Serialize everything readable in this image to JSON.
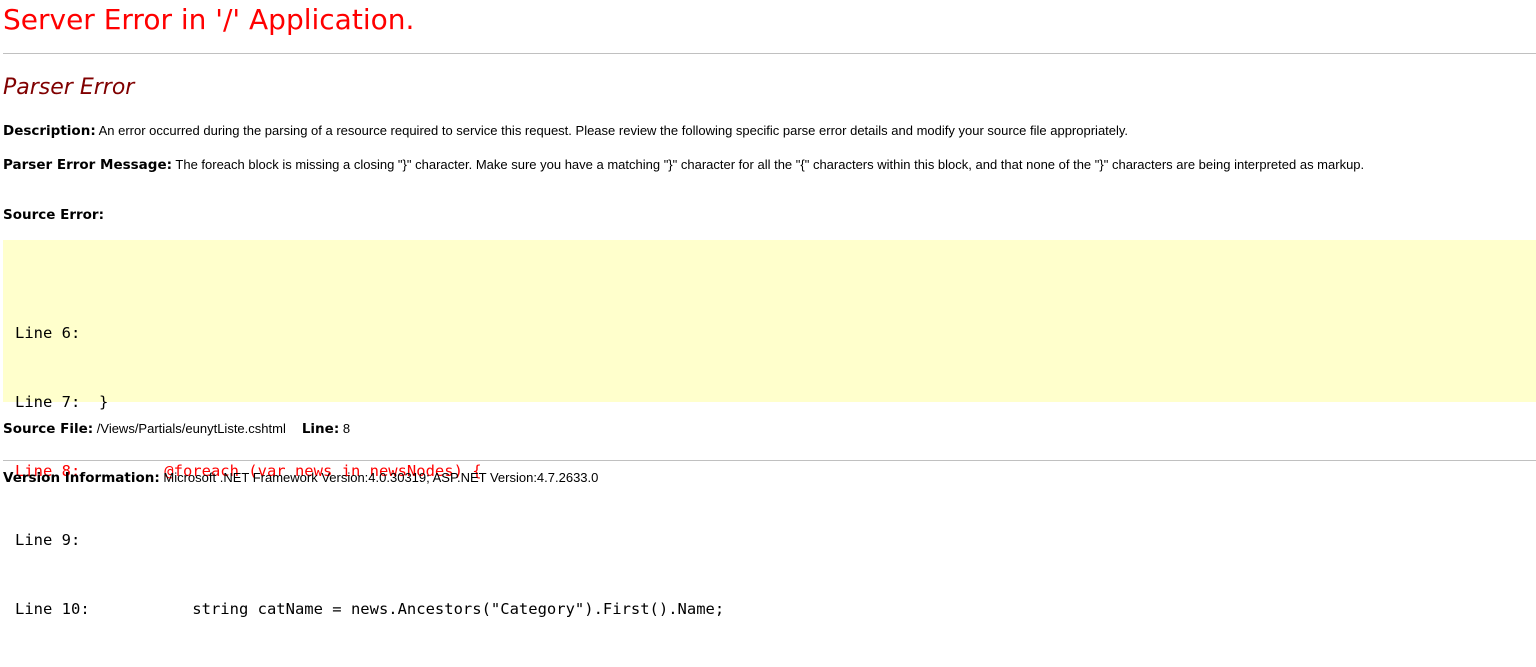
{
  "page": {
    "title": "Server Error in '/' Application.",
    "error_heading": "Parser Error"
  },
  "description": {
    "label": "Description:",
    "text": " An error occurred during the parsing of a resource required to service this request. Please review the following specific parse error details and modify your source file appropriately."
  },
  "parser_message": {
    "label": "Parser Error Message:",
    "text": " The foreach block is missing a closing \"}\" character.  Make sure you have a matching \"}\" character for all the \"{\" characters within this block, and that none of the \"}\" characters are being interpreted as markup."
  },
  "source_error": {
    "label": "Source Error:",
    "lines": [
      {
        "text": "Line 6:   ",
        "highlighted": false
      },
      {
        "text": "Line 7:  }",
        "highlighted": false
      },
      {
        "text": "Line 8:         @foreach (var news in newsNodes) {",
        "highlighted": true
      },
      {
        "text": "Line 9:   ",
        "highlighted": false
      },
      {
        "text": "Line 10:           string catName = news.Ancestors(\"Category\").First().Name;",
        "highlighted": false
      }
    ]
  },
  "source_file": {
    "label": "Source File:",
    "path": " /Views/Partials/eunytListe.cshtml",
    "line_label": "Line:",
    "line_number": " 8"
  },
  "version": {
    "label": "Version Information:",
    "text": " Microsoft .NET Framework Version:4.0.30319; ASP.NET Version:4.7.2633.0"
  },
  "colors": {
    "title": "#ff0000",
    "heading": "#800000",
    "code_background": "#ffffcc",
    "error_line": "#ff0000",
    "rule": "#c0c0c0"
  }
}
